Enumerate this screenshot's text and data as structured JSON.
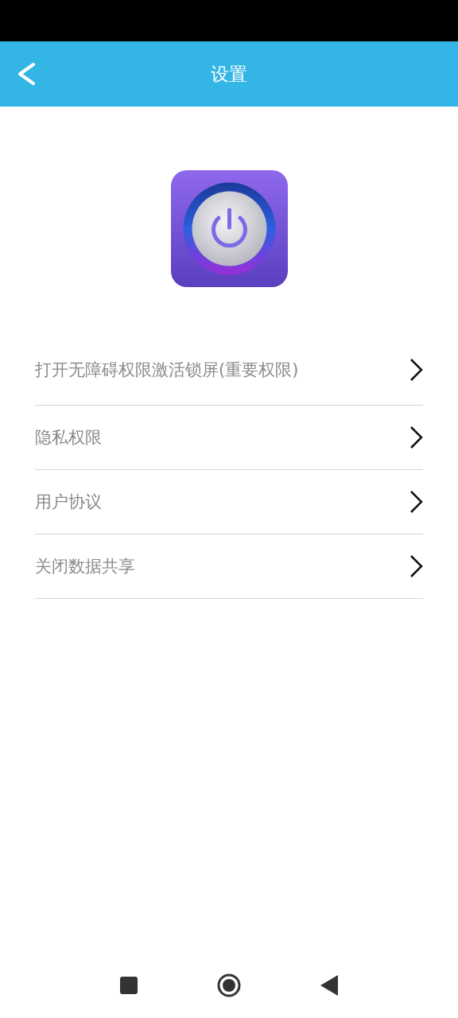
{
  "header": {
    "title": "设置"
  },
  "menu": [
    {
      "label": "打开无障碍权限激活锁屏(重要权限)"
    },
    {
      "label": "隐私权限"
    },
    {
      "label": "用户协议"
    },
    {
      "label": "关闭数据共享"
    }
  ]
}
